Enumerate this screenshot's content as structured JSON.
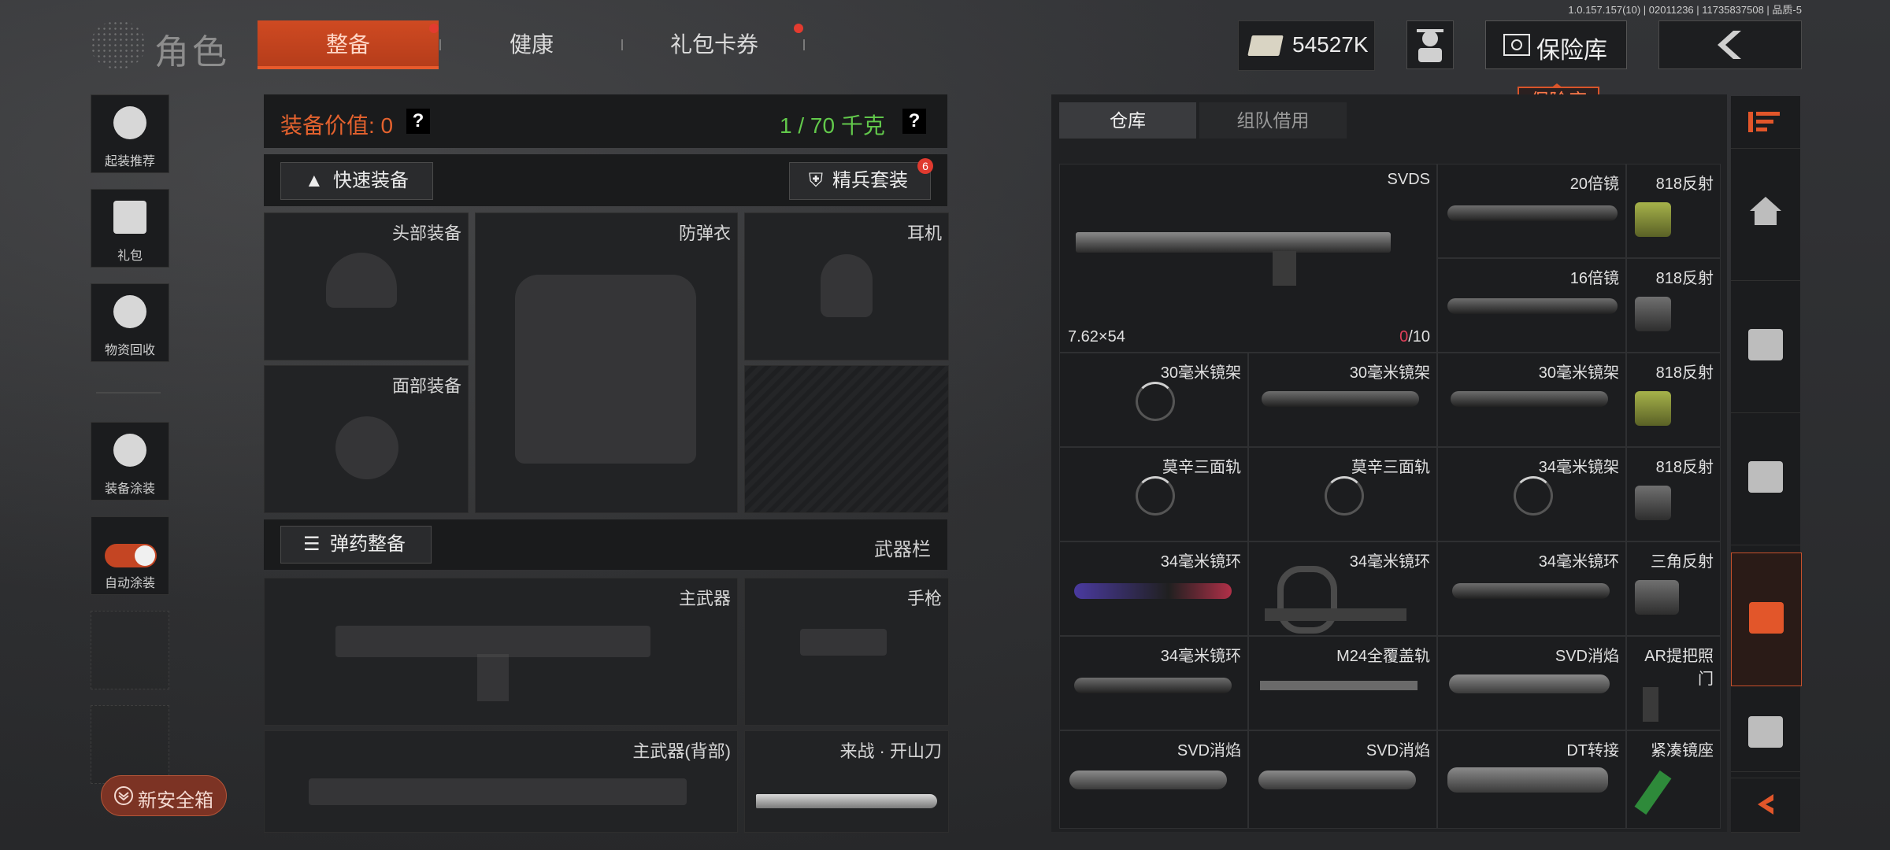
{
  "version": "1.0.157.157(10) | 02011236 | 11735837508 | 品质-5",
  "header": {
    "title": "角色",
    "tabs": [
      {
        "label": "整备",
        "active": true,
        "dot": true
      },
      {
        "label": "健康",
        "active": false,
        "dot": false
      },
      {
        "label": "礼包卡券",
        "active": false,
        "dot": true
      }
    ],
    "currency": "54527K",
    "vault_label": "保险库",
    "vault_tooltip": "保险库"
  },
  "sidebar": {
    "items": [
      {
        "label": "起装推荐",
        "icon": "helmet-icon"
      },
      {
        "label": "礼包",
        "icon": "gift-icon"
      },
      {
        "label": "物资回收",
        "icon": "recycle-icon"
      },
      {
        "label": "装备涂装",
        "icon": "paint-icon"
      },
      {
        "label": "自动涂装",
        "icon": "toggle-icon",
        "toggle_on": true
      }
    ],
    "safe_box": "新安全箱"
  },
  "equipment": {
    "value_label": "装备价值: 0",
    "weight_label": "1 / 70 千克",
    "quick_equip": "快速装备",
    "elite_suit": "精兵套装",
    "elite_badge": "6",
    "slots": {
      "head": "头部装备",
      "armor": "防弹衣",
      "headset": "耳机",
      "face": "面部装备"
    },
    "ammo_button": "弹药整备",
    "weapon_bar": "武器栏",
    "weapons": {
      "primary": "主武器",
      "pistol": "手枪",
      "primary_back": "主武器(背部)",
      "melee": "来战 · 开山刀"
    }
  },
  "warehouse": {
    "tabs": [
      "仓库",
      "组队借用"
    ],
    "featured": {
      "name": "SVDS",
      "caliber": "7.62×54",
      "ammo_current": "0",
      "ammo_max": "/10"
    },
    "items": [
      [
        "20倍镜",
        "818反射"
      ],
      [
        "16倍镜",
        "818反射"
      ],
      [
        "30毫米镜架",
        "30毫米镜架",
        "30毫米镜架",
        "818反射"
      ],
      [
        "莫辛三面轨",
        "莫辛三面轨",
        "34毫米镜架",
        "818反射"
      ],
      [
        "34毫米镜环",
        "34毫米镜环",
        "34毫米镜环",
        "三角反射"
      ],
      [
        "34毫米镜环",
        "M24全覆盖轨",
        "SVD消焰",
        "AR提把照门"
      ],
      [
        "SVD消焰",
        "SVD消焰",
        "DT转接",
        "紧凑镜座"
      ]
    ]
  }
}
